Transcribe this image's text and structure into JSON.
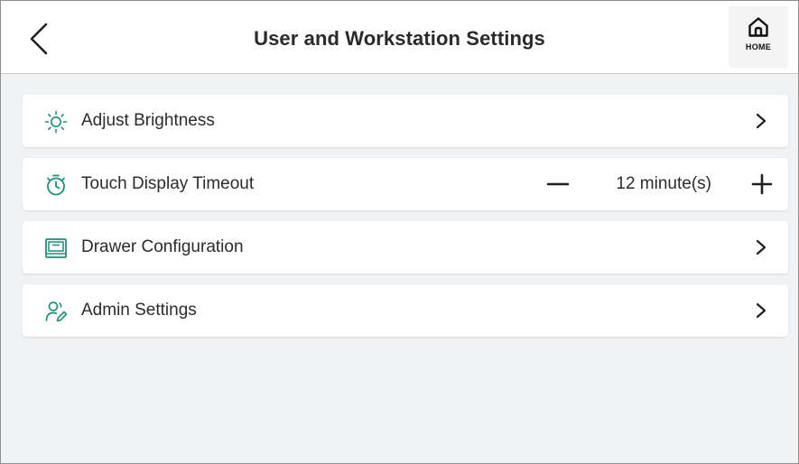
{
  "header": {
    "title": "User and Workstation Settings",
    "back_icon": "chevron-left-icon",
    "home_label": "HOME",
    "home_icon": "home-icon"
  },
  "settings": {
    "accent_color": "#1e8f7e",
    "items": [
      {
        "label": "Adjust Brightness",
        "icon": "sun-icon",
        "action_icon": "chevron-right-icon"
      },
      {
        "label": "Touch Display Timeout",
        "icon": "timer-icon",
        "value": "12 minute(s)",
        "decrement_icon": "minus-icon",
        "increment_icon": "plus-icon"
      },
      {
        "label": "Drawer Configuration",
        "icon": "drawer-icon",
        "action_icon": "chevron-right-icon"
      },
      {
        "label": "Admin Settings",
        "icon": "admin-user-edit-icon",
        "action_icon": "chevron-right-icon"
      }
    ]
  }
}
